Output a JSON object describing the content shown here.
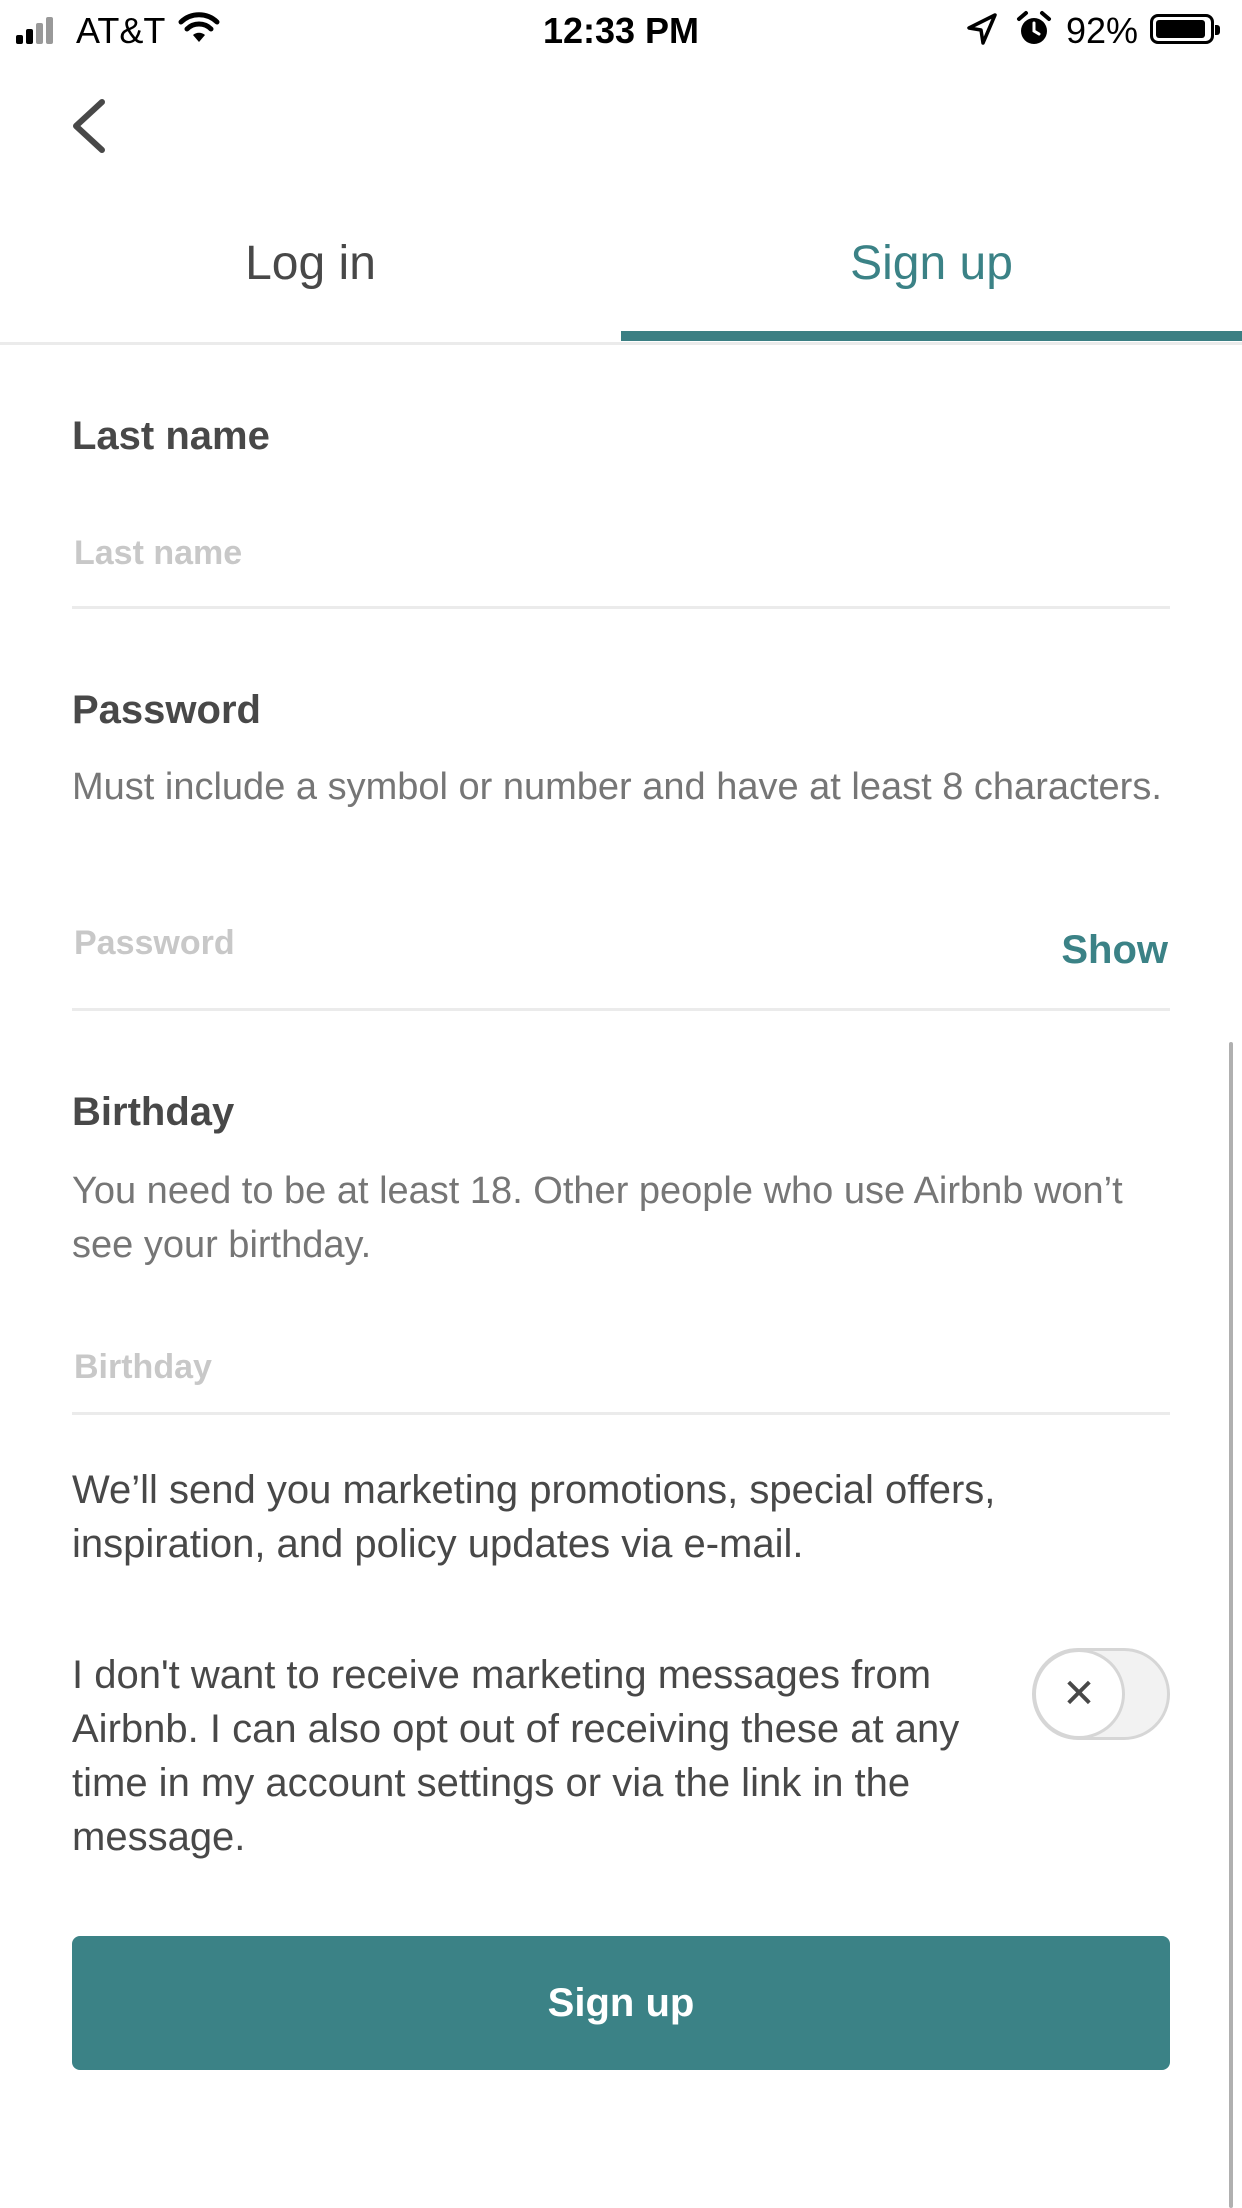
{
  "status_bar": {
    "carrier": "AT&T",
    "time": "12:33 PM",
    "battery": "92%"
  },
  "tabs": [
    {
      "label": "Log in",
      "active": false
    },
    {
      "label": "Sign up",
      "active": true
    }
  ],
  "colors": {
    "accent": "#3b8286",
    "text": "#484848",
    "muted": "#767676",
    "placeholder": "#c8c8c8"
  },
  "form": {
    "last_name": {
      "label": "Last name",
      "placeholder": "Last name"
    },
    "password": {
      "label": "Password",
      "help": "Must include a symbol or number and have at least 8 characters.",
      "placeholder": "Password",
      "show_label": "Show"
    },
    "birthday": {
      "label": "Birthday",
      "help": "You need to be at least 18. Other people who use Airbnb won’t see your birthday.",
      "placeholder": "Birthday"
    }
  },
  "marketing": {
    "notice": "We’ll send you marketing promotions, special offers, inspiration, and policy updates via e-mail.",
    "opt_out": "I don't want to receive marketing messages from Airbnb. I can also opt out of receiving these at any time in my account settings or via the link in the message.",
    "toggle_on": false
  },
  "submit_label": "Sign up"
}
